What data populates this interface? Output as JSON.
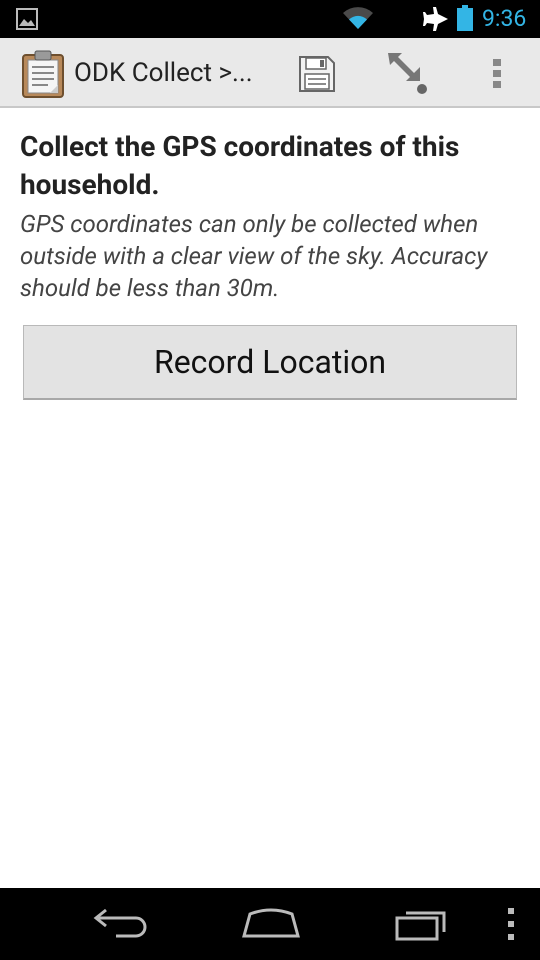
{
  "status_bar": {
    "time": "9:36",
    "icons": [
      "picture-icon",
      "wifi-icon",
      "airplane-mode-icon",
      "battery-icon"
    ],
    "clock_color": "#33b5e5"
  },
  "action_bar": {
    "title": "ODK Collect >...",
    "actions": [
      "save-icon",
      "go-to-prompt-icon",
      "overflow-menu-icon"
    ]
  },
  "question": {
    "label": "Collect the GPS coordinates of this household.",
    "hint": "GPS coordinates can only be collected when outside with a clear view of the sky. Accuracy should be less than 30m.",
    "button_label": "Record Location"
  },
  "nav_bar": {
    "buttons": [
      "back-icon",
      "home-icon",
      "recent-apps-icon",
      "menu-icon"
    ]
  }
}
